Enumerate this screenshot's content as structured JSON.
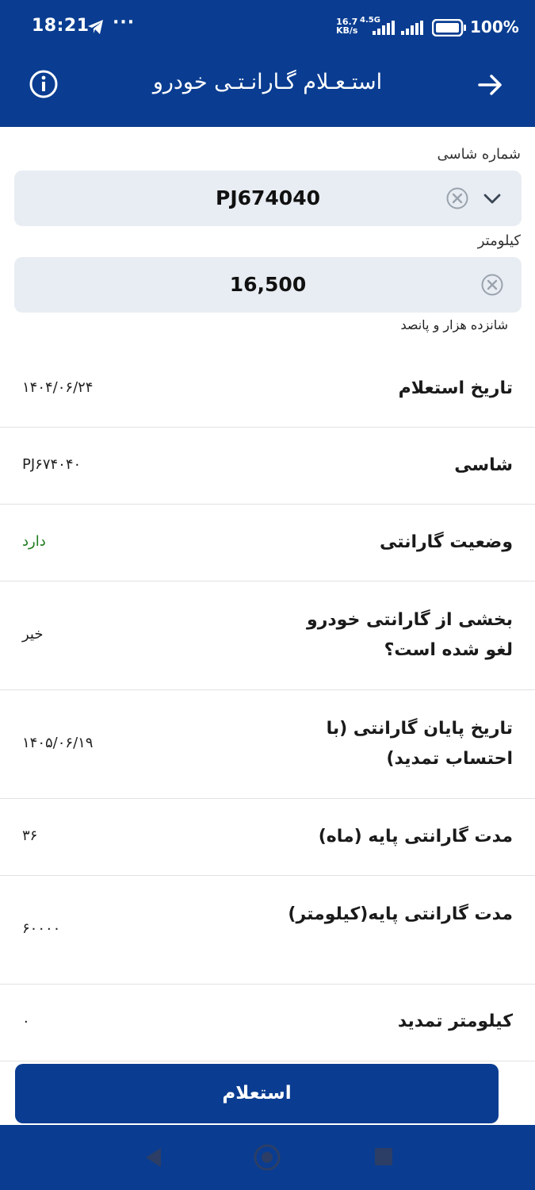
{
  "status_bar": {
    "time": "18:21",
    "notification_icons": [
      "telegram-icon",
      "more-dots-icon"
    ],
    "dots": "···",
    "net_speed_value": "16.7",
    "net_speed_unit": "KB/s",
    "network_type": "4.5G",
    "battery": "100%"
  },
  "app_bar": {
    "title": "استـعـلام گـارانـتـی خودرو",
    "info_icon": "info-icon",
    "back_icon": "arrow-right-icon"
  },
  "form": {
    "chassis": {
      "label": "شماره شاسی",
      "value": "PJ674040"
    },
    "kilometer": {
      "label": "کیلومتر",
      "value": "16,500",
      "helper": "شانزده هزار و پانصد"
    }
  },
  "results": [
    {
      "label": "تاریخ استعلام",
      "value": "۱۴۰۴/۰۶/۲۴"
    },
    {
      "label": "شاسی",
      "value": "PJ۶۷۴۰۴۰"
    },
    {
      "label": "وضعیت گارانتی",
      "value": "دارد"
    },
    {
      "label": "بخشی از گارانتی خودرو لغو شده است؟",
      "value": "خیر"
    },
    {
      "label": "تاریخ پایان گارانتی (با احتساب تمدید)",
      "value": "۱۴۰۵/۰۶/۱۹"
    },
    {
      "label": "مدت گارانتی پایه (ماه)",
      "value": "۳۶"
    },
    {
      "label": "مدت گارانتی پایه(کیلومتر)",
      "value": "۶۰۰۰۰"
    },
    {
      "label": "کیلومتر تمدید",
      "value": "۰"
    }
  ],
  "submit_button": {
    "label": "استعلام"
  },
  "colors": {
    "primary": "#0a3d91",
    "field_bg": "#e8edf3",
    "status_ok": "#1b7a1b"
  }
}
